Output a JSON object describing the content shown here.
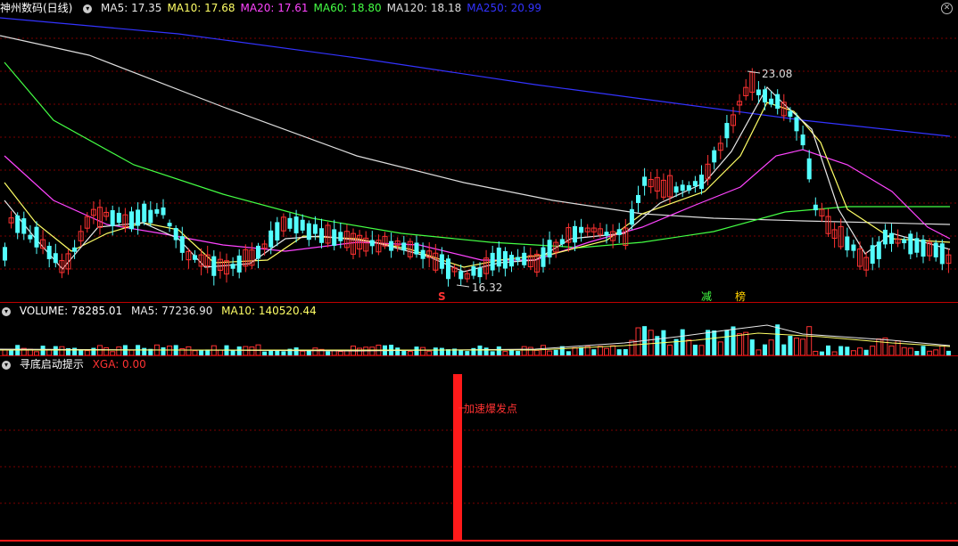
{
  "main": {
    "title": "神州数码(日线)",
    "ma": [
      {
        "label": "MA5: 17.35",
        "color": "#e8e8e8"
      },
      {
        "label": "MA10: 17.68",
        "color": "#ffff66"
      },
      {
        "label": "MA20: 17.61",
        "color": "#ff44ff"
      },
      {
        "label": "MA60: 18.80",
        "color": "#44ff44"
      },
      {
        "label": "MA120: 18.18",
        "color": "#dddddd"
      },
      {
        "label": "MA250: 20.99",
        "color": "#3333ff"
      }
    ],
    "high_label": "23.08",
    "low_label": "16.32",
    "marker_s": "S",
    "marker_jian": "减",
    "marker_bang": "榜",
    "close_icon": "x-icon"
  },
  "volume": {
    "label": "VOLUME: 78285.01",
    "ma5": "MA5: 77236.90",
    "ma10": "MA10: 140520.44"
  },
  "indicator": {
    "title": "寻底启动提示",
    "xga": "XGA: 0.00",
    "annotation": "加速爆发点"
  },
  "colors": {
    "up": "#ff3232",
    "down": "#54ffff",
    "ma250": "#3333ff",
    "ma120": "#dddddd",
    "ma60": "#44ff44",
    "ma20": "#ff44ff",
    "ma10": "#ffff66",
    "ma5": "#e8e8e8",
    "grid": "#7a0000",
    "separator": "#c00000"
  }
}
